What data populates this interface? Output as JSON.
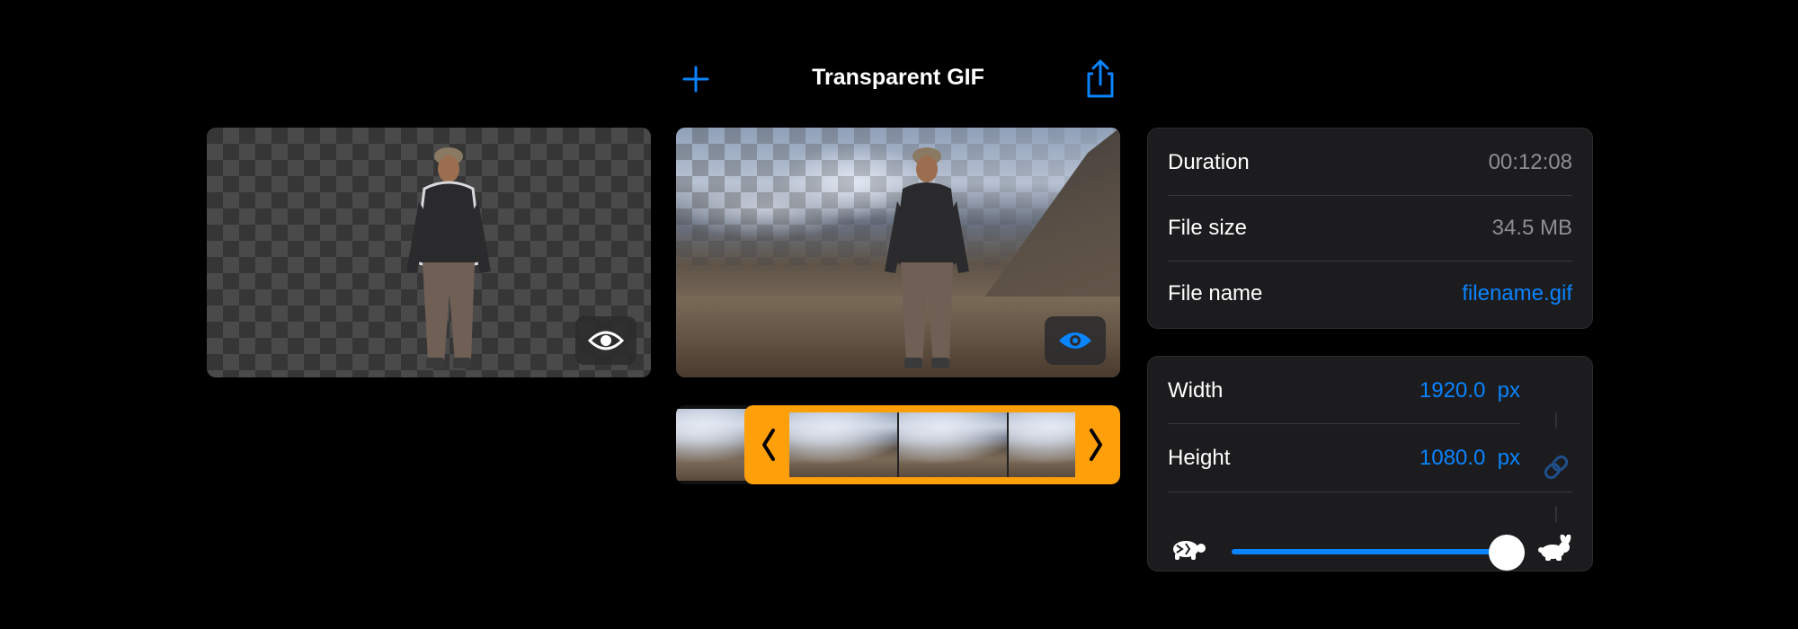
{
  "header": {
    "title": "Transparent GIF"
  },
  "info": {
    "duration_label": "Duration",
    "duration_value": "00:12:08",
    "filesize_label": "File size",
    "filesize_value": "34.5 MB",
    "filename_label": "File name",
    "filename_value": "filename.gif"
  },
  "dimensions": {
    "width_label": "Width",
    "width_value": "1920.0",
    "width_unit": "px",
    "height_label": "Height",
    "height_value": "1080.0",
    "height_unit": "px"
  },
  "speed": {
    "level": 0.85,
    "slow_icon": "turtle-icon",
    "fast_icon": "rabbit-icon"
  },
  "colors": {
    "accent": "#0a84ff",
    "trim_handle": "#ff9f0a"
  },
  "previews": {
    "transparent_eye_state": "off",
    "original_eye_state": "on"
  }
}
